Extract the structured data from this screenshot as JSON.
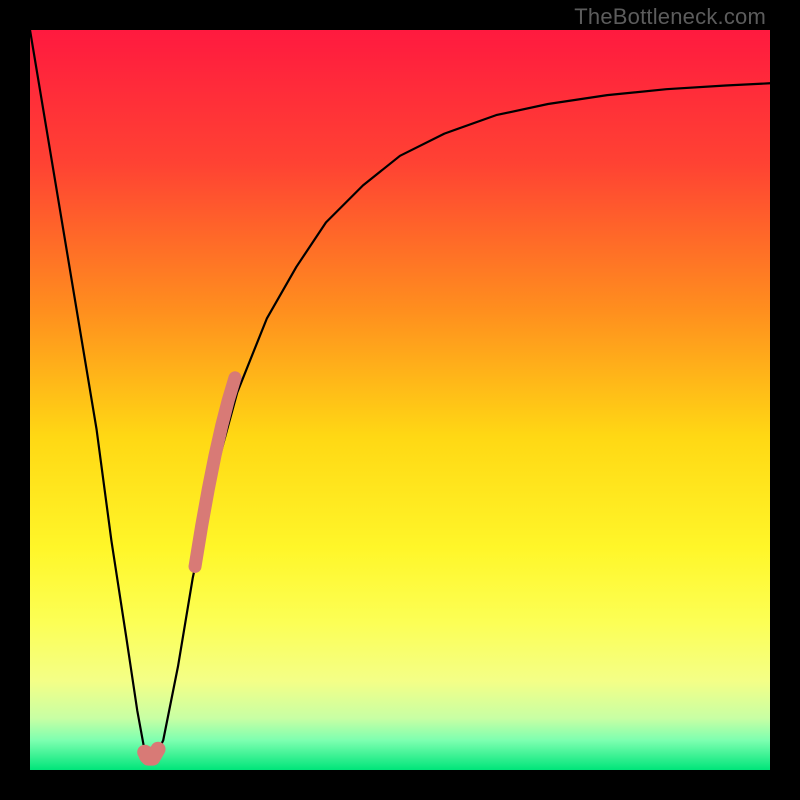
{
  "watermark": "TheBottleneck.com",
  "chart_data": {
    "type": "line",
    "title": "",
    "xlabel": "",
    "ylabel": "",
    "xlim": [
      0,
      100
    ],
    "ylim": [
      0,
      100
    ],
    "gradient_stops": [
      {
        "offset": 0,
        "color": "#ff1a3f"
      },
      {
        "offset": 18,
        "color": "#ff4233"
      },
      {
        "offset": 38,
        "color": "#ff8f1e"
      },
      {
        "offset": 55,
        "color": "#ffd814"
      },
      {
        "offset": 70,
        "color": "#fff629"
      },
      {
        "offset": 80,
        "color": "#fcff55"
      },
      {
        "offset": 88,
        "color": "#f4ff87"
      },
      {
        "offset": 93,
        "color": "#c8ffa4"
      },
      {
        "offset": 96,
        "color": "#7dffb0"
      },
      {
        "offset": 100,
        "color": "#00e57a"
      }
    ],
    "series": [
      {
        "name": "bottleneck-curve",
        "x": [
          0,
          3,
          6,
          9,
          11,
          13,
          14.5,
          15.6,
          16.5,
          18,
          20,
          22,
          25,
          28,
          32,
          36,
          40,
          45,
          50,
          56,
          63,
          70,
          78,
          86,
          94,
          100
        ],
        "values": [
          100,
          82,
          64,
          46,
          31,
          18,
          8,
          2,
          1,
          4,
          14,
          26,
          40,
          51,
          61,
          68,
          74,
          79,
          83,
          86,
          88.5,
          90,
          91.2,
          92,
          92.5,
          92.8
        ]
      }
    ],
    "highlight_segments": [
      {
        "name": "highlight-upper",
        "color": "#d87a76",
        "width": 13,
        "x": [
          22.3,
          23.2,
          24.1,
          25.0,
          25.9,
          26.8,
          27.7
        ],
        "values": [
          27.5,
          33.0,
          38.0,
          42.5,
          46.5,
          50.0,
          53.0
        ]
      },
      {
        "name": "highlight-lower",
        "color": "#d87a76",
        "width": 15,
        "x": [
          15.5,
          16.0,
          16.6,
          17.3
        ],
        "values": [
          2.4,
          1.6,
          1.6,
          2.8
        ]
      }
    ],
    "highlight_dot": {
      "name": "highlight-dot",
      "color": "#d87a76",
      "r": 9,
      "x": 15.9,
      "value": 2.0
    }
  }
}
